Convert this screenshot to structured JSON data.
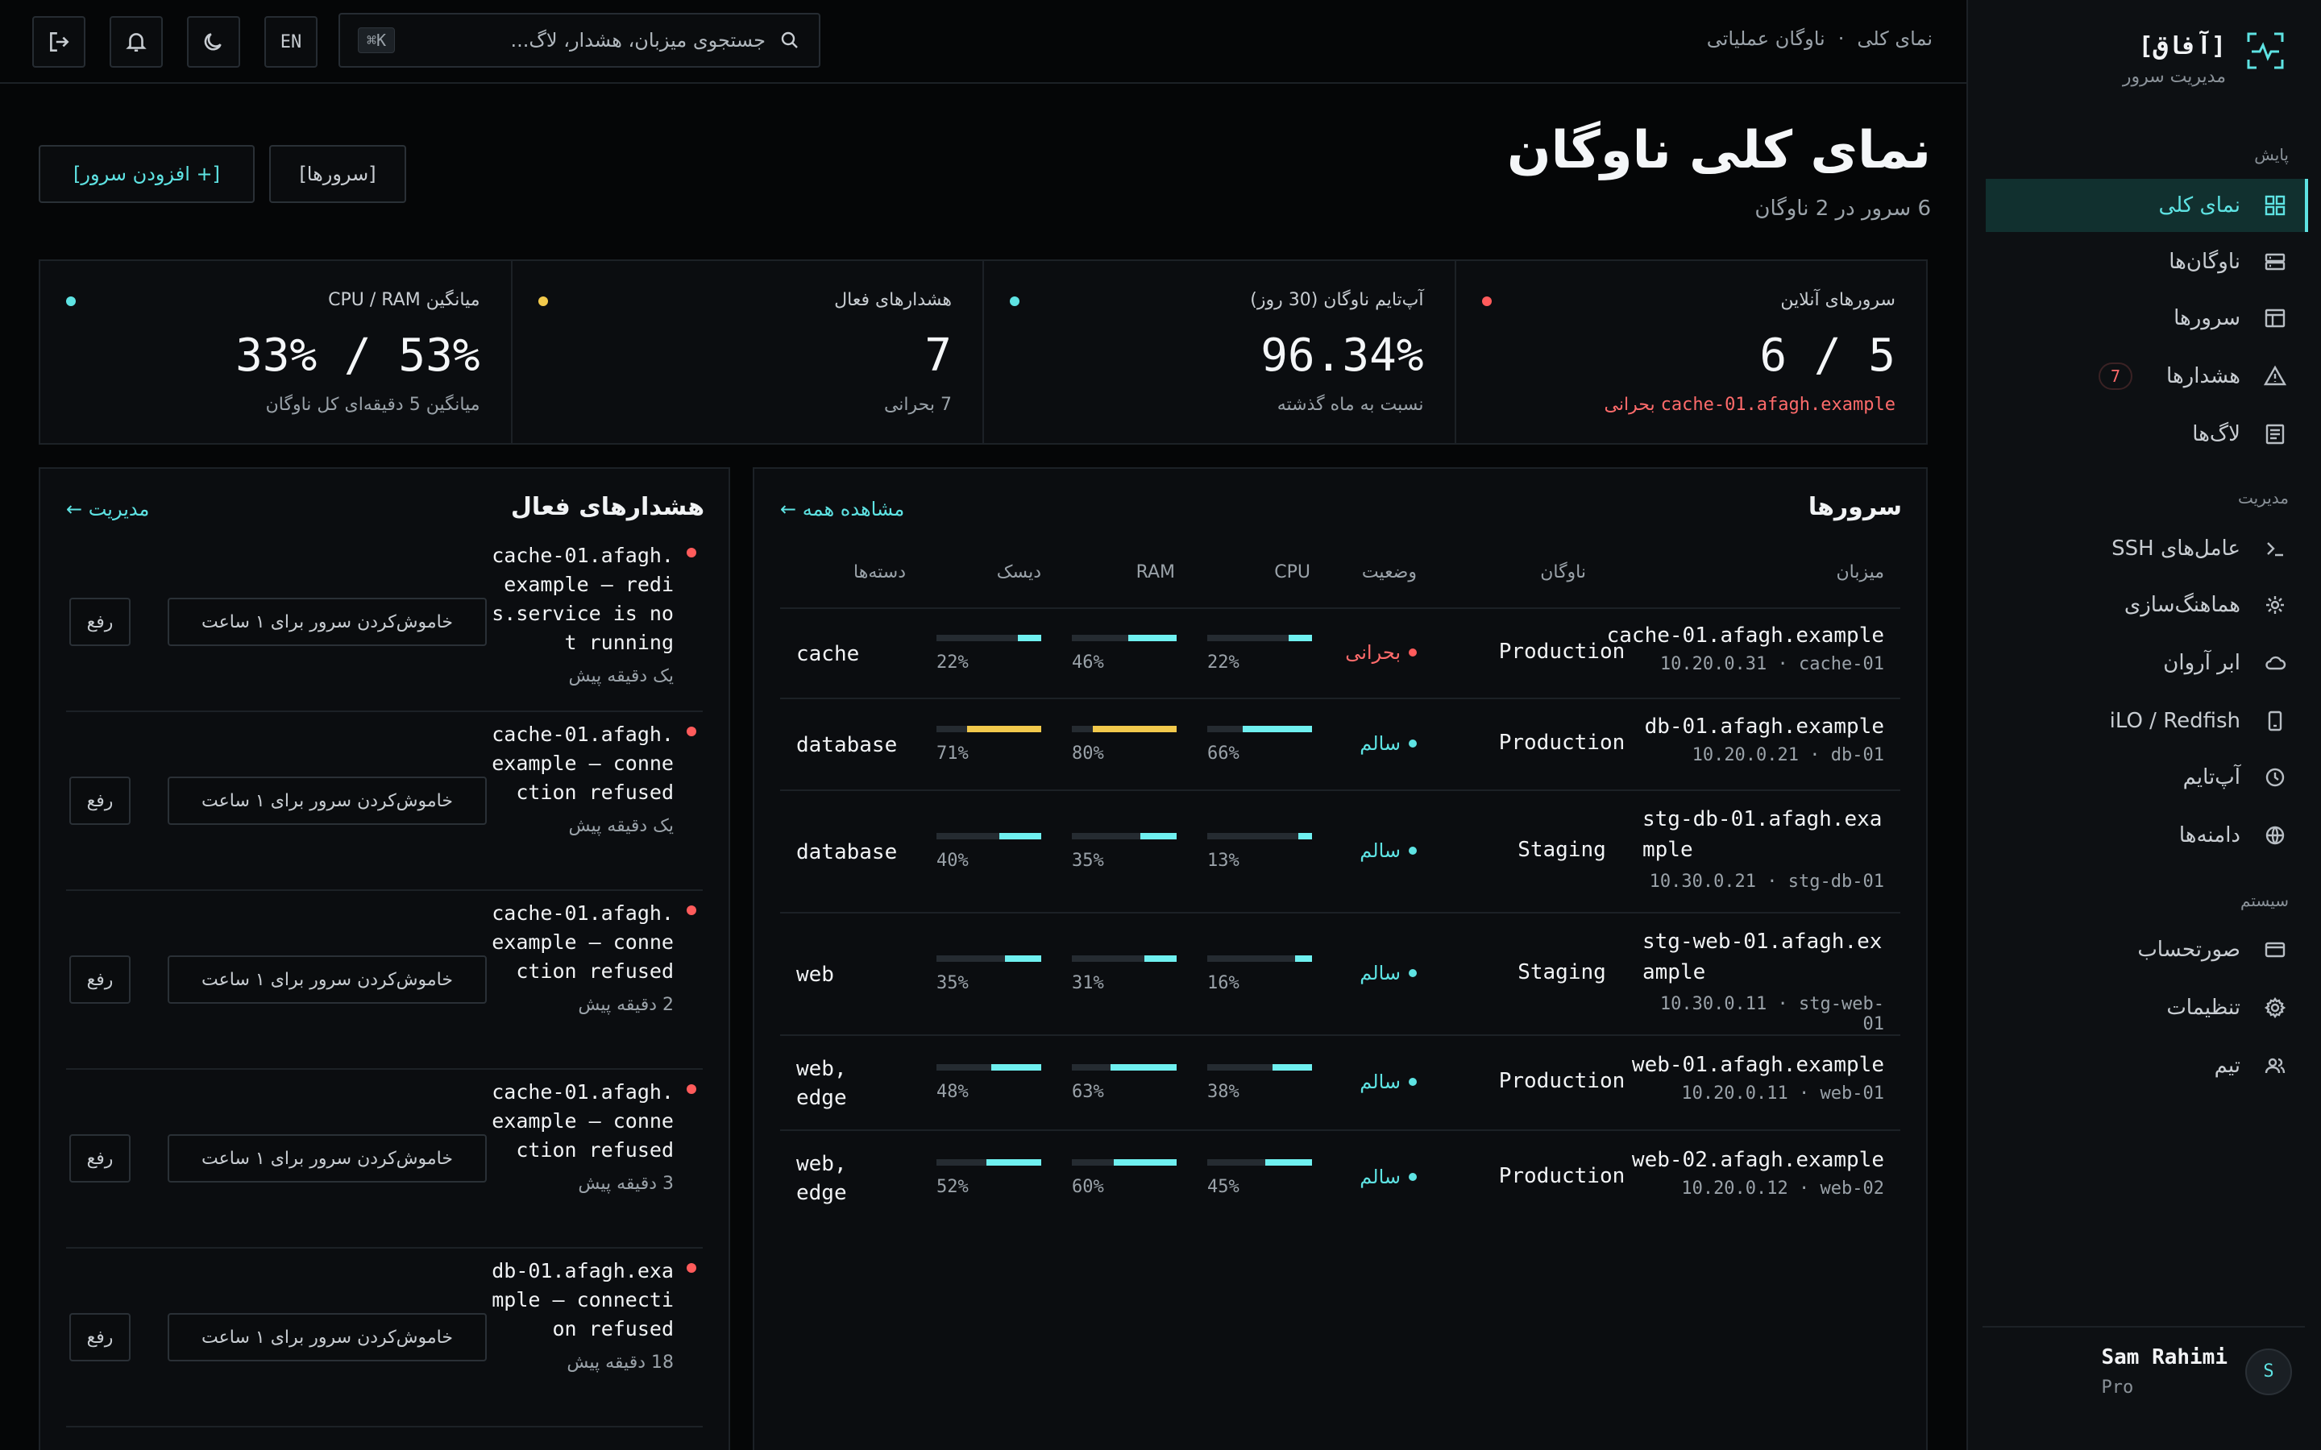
{
  "brand": {
    "title": "[آفاق]",
    "subtitle": "مدیریت سرور"
  },
  "nav": {
    "sections": {
      "monitoring": "پایش",
      "management": "مدیریت",
      "system": "سیستم"
    },
    "items": [
      {
        "label": "نمای کلی",
        "icon": "grid-icon"
      },
      {
        "label": "ناوگان‌ها",
        "icon": "server-stack-icon"
      },
      {
        "label": "سرورها",
        "icon": "table-icon"
      },
      {
        "label": "هشدارها",
        "icon": "warning-icon",
        "badge": "7"
      },
      {
        "label": "لاگ‌ها",
        "icon": "log-icon"
      },
      {
        "label": "عامل‌های SSH",
        "icon": "terminal-icon"
      },
      {
        "label": "هماهنگ‌سازی",
        "icon": "sync-icon"
      },
      {
        "label": "ابر آروان",
        "icon": "cloud-icon"
      },
      {
        "label": "iLO / Redfish",
        "icon": "device-icon"
      },
      {
        "label": "آپ‌تایم",
        "icon": "clock-icon"
      },
      {
        "label": "دامنه‌ها",
        "icon": "globe-icon"
      },
      {
        "label": "صورتحساب",
        "icon": "card-icon"
      },
      {
        "label": "تنظیمات",
        "icon": "gear-icon"
      },
      {
        "label": "تیم",
        "icon": "team-icon"
      }
    ]
  },
  "user": {
    "initial": "S",
    "name": "Sam Rahimi",
    "plan": "Pro"
  },
  "topbar": {
    "breadcrumb": [
      "نمای کلی",
      "·",
      "ناوگان عملیاتی"
    ],
    "search_placeholder": "جستجوی میزبان، هشدار، لاگ...",
    "shortcut": "⌘K",
    "lang": "EN"
  },
  "header": {
    "title": "نمای کلی ناوگان",
    "subtitle": "6 سرور در 2 ناوگان",
    "servers_button": "[سرورها]",
    "add_button": "[+ افزودن سرور]"
  },
  "stats": [
    {
      "label": "سرورهای آنلاین",
      "value": "6 / 5",
      "foot_host": "cache-01.afagh.example",
      "foot_status": "بحرانی",
      "dot": "#ff5b5b"
    },
    {
      "label": "آپ‌تایم ناوگان (30 روز)",
      "value": "96.34%",
      "foot": "نسبت به ماه گذشته",
      "dot": "#5ee3e3"
    },
    {
      "label": "هشدارهای فعال",
      "value": "7",
      "foot": "7 بحرانی",
      "dot": "#f2c94c"
    },
    {
      "label": "میانگین CPU / RAM",
      "value": "33% / 53%",
      "foot": "میانگین 5 دقیقه‌ای کل ناوگان",
      "dot": "#5ee3e3"
    }
  ],
  "servers": {
    "title": "سرورها",
    "view_all": "مشاهده همه ←",
    "columns": {
      "host": "میزبان",
      "fleet": "ناوگان",
      "status": "وضعیت",
      "cpu": "CPU",
      "ram": "RAM",
      "disk": "دیسک",
      "roles": "دسته‌ها"
    },
    "rows": [
      {
        "host": "cache-01.afagh.example",
        "ip": "10.20.0.31 · cache-01",
        "fleet": "Production",
        "status": "بحرانی",
        "critical": true,
        "cpu": 22,
        "ram": 46,
        "disk": 22,
        "cpu_label": "22%",
        "ram_label": "46%",
        "disk_label": "22%",
        "roles": "cache"
      },
      {
        "host": "db-01.afagh.example",
        "ip": "10.20.0.21 · db-01",
        "fleet": "Production",
        "status": "سالم",
        "critical": false,
        "cpu": 66,
        "ram": 80,
        "disk": 71,
        "cpu_label": "66%",
        "ram_label": "80%",
        "disk_label": "71%",
        "roles": "database"
      },
      {
        "host": "stg-db-01.afagh.example",
        "ip": "10.30.0.21 · stg-db-01",
        "fleet": "Staging",
        "status": "سالم",
        "critical": false,
        "cpu": 13,
        "ram": 35,
        "disk": 40,
        "cpu_label": "13%",
        "ram_label": "35%",
        "disk_label": "40%",
        "roles": "database"
      },
      {
        "host": "stg-web-01.afagh.example",
        "ip": "10.30.0.11 · stg-web-01",
        "fleet": "Staging",
        "status": "سالم",
        "critical": false,
        "cpu": 16,
        "ram": 31,
        "disk": 35,
        "cpu_label": "16%",
        "ram_label": "31%",
        "disk_label": "35%",
        "roles": "web"
      },
      {
        "host": "web-01.afagh.example",
        "ip": "10.20.0.11 · web-01",
        "fleet": "Production",
        "status": "سالم",
        "critical": false,
        "cpu": 38,
        "ram": 63,
        "disk": 48,
        "cpu_label": "38%",
        "ram_label": "63%",
        "disk_label": "48%",
        "roles": "web, edge"
      },
      {
        "host": "web-02.afagh.example",
        "ip": "10.20.0.12 · web-02",
        "fleet": "Production",
        "status": "سالم",
        "critical": false,
        "cpu": 45,
        "ram": 60,
        "disk": 52,
        "cpu_label": "45%",
        "ram_label": "60%",
        "disk_label": "52%",
        "roles": "web, edge"
      }
    ]
  },
  "alerts": {
    "title": "هشدارهای فعال",
    "manage": "مدیریت ←",
    "silence_label": "خاموش‌کردن سرور برای ۱ ساعت",
    "resolve_label": "رفع",
    "items": [
      {
        "text": "cache-01.afagh.example — redis.service is not running",
        "time": "یک دقیقه پیش"
      },
      {
        "text": "cache-01.afagh.example — connection refused",
        "time": "یک دقیقه پیش"
      },
      {
        "text": "cache-01.afagh.example — connection refused",
        "time": "2 دقیقه پیش"
      },
      {
        "text": "cache-01.afagh.example — connection refused",
        "time": "3 دقیقه پیش"
      },
      {
        "text": "db-01.afagh.example — connection refused",
        "time": "18 دقیقه پیش"
      }
    ]
  },
  "colors": {
    "accent": "#5ee3e3",
    "critical": "#ff5b5b",
    "warning": "#f2c94c",
    "background": "#050607"
  }
}
